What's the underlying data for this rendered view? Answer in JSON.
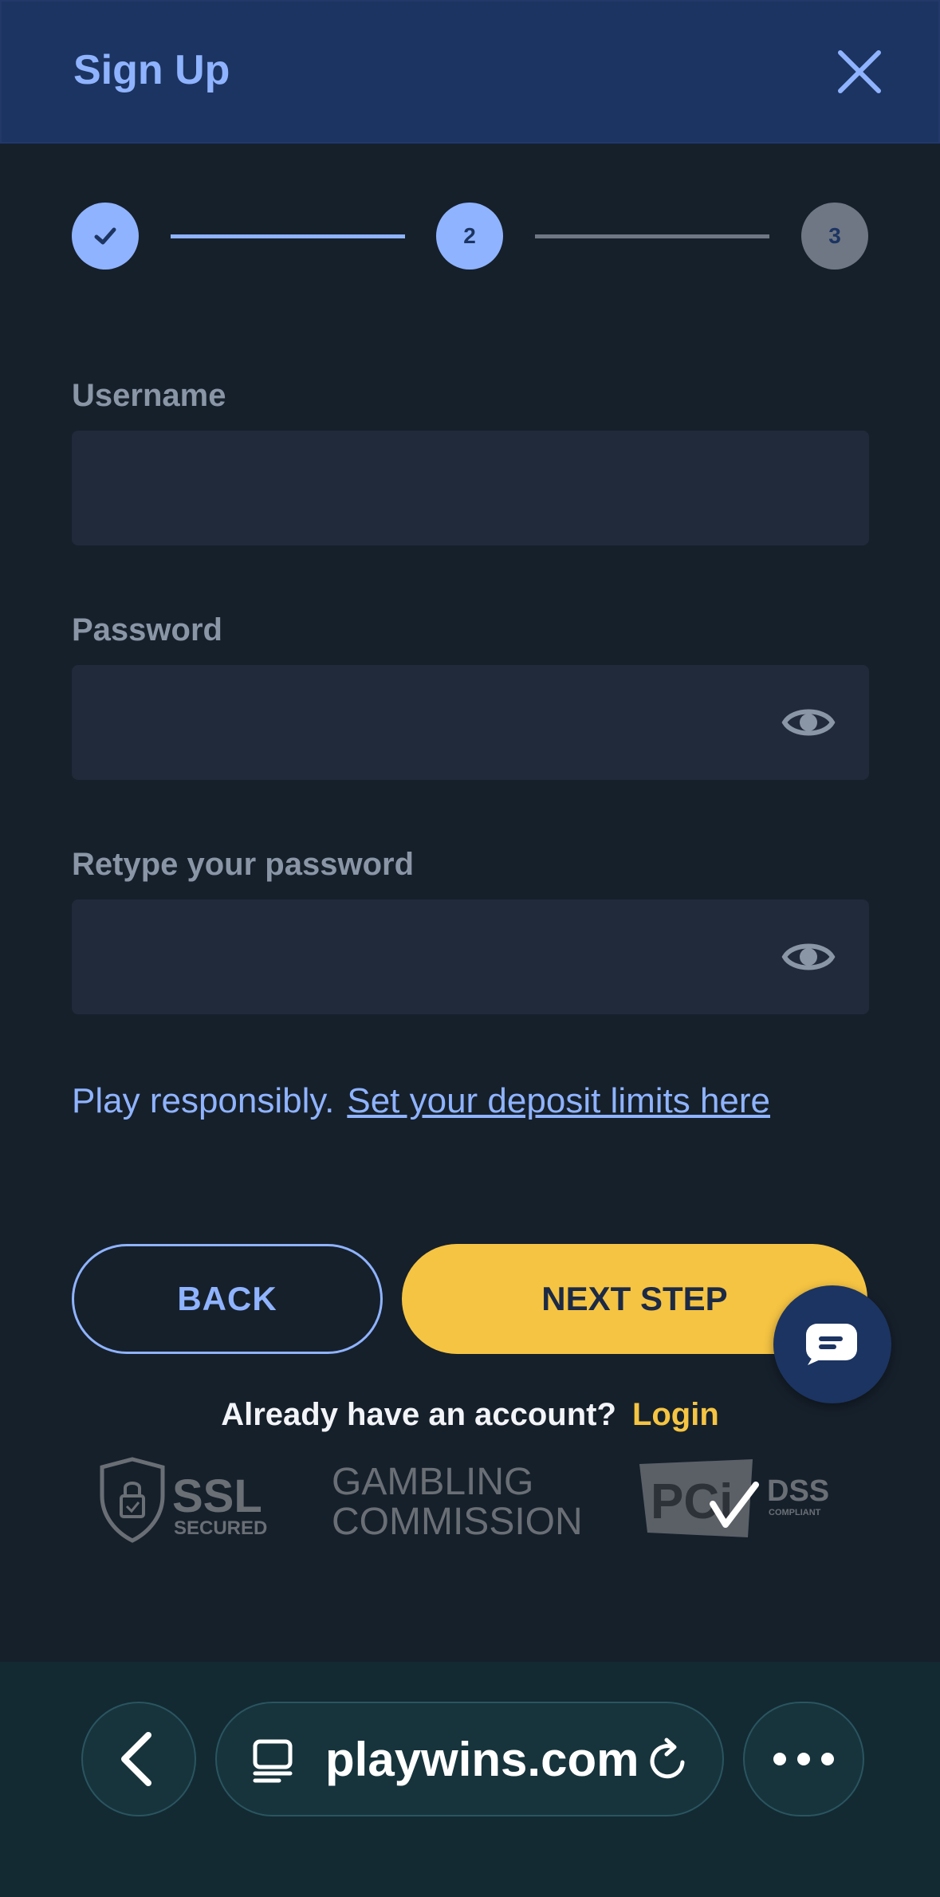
{
  "header": {
    "title": "Sign Up"
  },
  "stepper": {
    "step2": "2",
    "step3": "3"
  },
  "form": {
    "username_label": "Username",
    "username_value": "",
    "password_label": "Password",
    "password_value": "",
    "retype_label": "Retype your password",
    "retype_value": ""
  },
  "responsible": {
    "text": "Play responsibly.",
    "link": "Set your deposit limits here"
  },
  "buttons": {
    "back": "BACK",
    "next": "NEXT STEP"
  },
  "login": {
    "prompt": "Already have an account?",
    "link": "Login"
  },
  "trust_logos": {
    "ssl_main": "SSL",
    "ssl_sub": "SECURED",
    "gambling_line1": "GAMBLING",
    "gambling_line2": "COMMISSION",
    "pci_main": "PCi",
    "pci_dss": "DSS",
    "pci_sub": "COMPLIANT"
  },
  "browser": {
    "url": "playwins.com"
  },
  "colors": {
    "header_bg": "#1c3461",
    "accent_blue": "#8fb3ff",
    "accent_yellow": "#f5c443",
    "page_bg": "#16202b",
    "input_bg": "#212a3b"
  }
}
